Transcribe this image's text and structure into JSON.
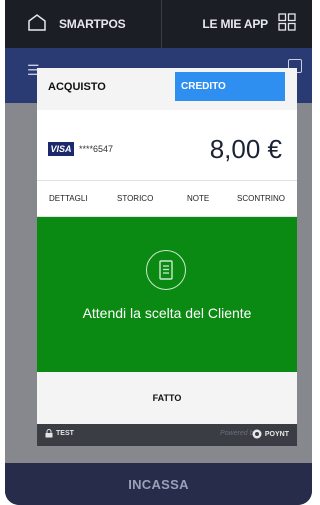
{
  "topbar": {
    "left_label": "SMARTPOS",
    "right_label": "LE MIE APP"
  },
  "bottom": {
    "label": "INCASSA"
  },
  "modal": {
    "title": "ACQUISTO",
    "credit_button": "CREDITO",
    "card": {
      "brand": "VISA",
      "masked_number": "****6547"
    },
    "amount": "8,00 €",
    "tabs": [
      "DETTAGLI",
      "STORICO",
      "NOTE",
      "SCONTRINO"
    ],
    "status_message": "Attendi la scelta del Cliente",
    "done_button": "FATTO",
    "footer": {
      "test_label": "TEST",
      "powered_by": "Powered by",
      "brand": "POYNT"
    }
  },
  "colors": {
    "accent_blue": "#2f8ff0",
    "status_green": "#0a8a12",
    "topbar": "#1b1e24",
    "bottom_bar": "#262c4a"
  },
  "icons": [
    "home-icon",
    "apps-grid-icon",
    "menu-icon",
    "receipt-icon",
    "lock-icon",
    "poynt-logo-icon"
  ]
}
